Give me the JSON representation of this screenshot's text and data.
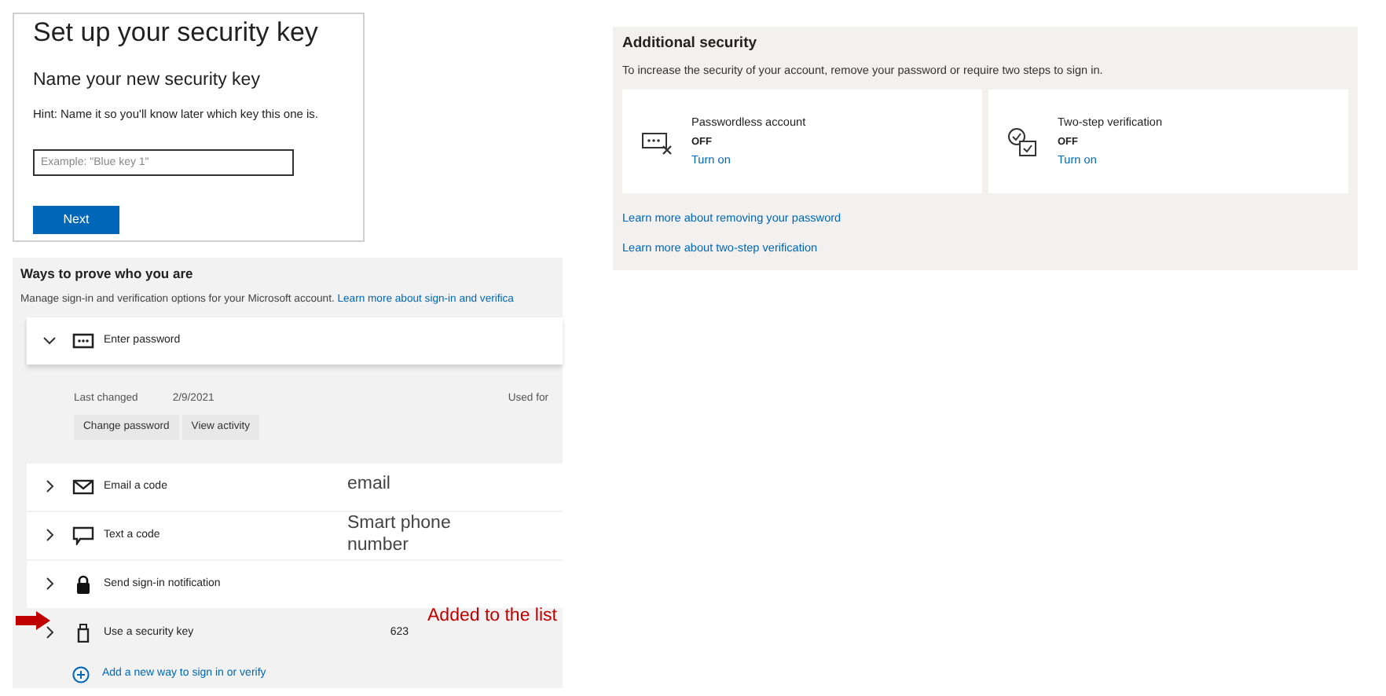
{
  "setup_card": {
    "title": "Set up your security key",
    "subtitle": "Name your new security key",
    "hint": "Hint: Name it so you'll know later which key this one is.",
    "name_field": {
      "placeholder": "Example: \"Blue key 1\""
    },
    "button": "Next"
  },
  "ways_panel": {
    "title": "Ways to prove who you are",
    "description": "Manage sign-in and verification options for your Microsoft account.",
    "description_link": "Learn more about sign-in and verifica",
    "methods": [
      {
        "kind": "password",
        "label": "Enter password",
        "expanded": true,
        "details": {
          "last_changed_label": "Last changed",
          "last_changed_value": "2/9/2021",
          "used_for_label": "Used for",
          "buttons": [
            "Change password",
            "View activity"
          ]
        }
      },
      {
        "kind": "email",
        "label": "Email a code",
        "expanded": false
      },
      {
        "kind": "sms",
        "label": "Text a code",
        "expanded": false
      },
      {
        "kind": "notification",
        "label": "Send sign-in notification",
        "expanded": false
      },
      {
        "kind": "key",
        "label": "Use a security key",
        "expanded": false,
        "value": "623"
      }
    ],
    "add_link": "Add a new way to sign in or verify"
  },
  "additional_security": {
    "title": "Additional security",
    "description": "To increase the security of your account, remove your password or require two steps to sign in.",
    "options": [
      {
        "kind": "passwordless",
        "title": "Passwordless account",
        "status": "OFF",
        "action": "Turn on"
      },
      {
        "kind": "two_step",
        "title": "Two-step verification",
        "status": "OFF",
        "action": "Turn on"
      }
    ],
    "links": [
      "Learn more about removing your password",
      "Learn more about two-step verification"
    ]
  },
  "annotations": [
    {
      "kind": "note",
      "text": "email"
    },
    {
      "kind": "note",
      "text": "Smart phone number"
    },
    {
      "kind": "highlight",
      "text": "Added to the list"
    }
  ]
}
